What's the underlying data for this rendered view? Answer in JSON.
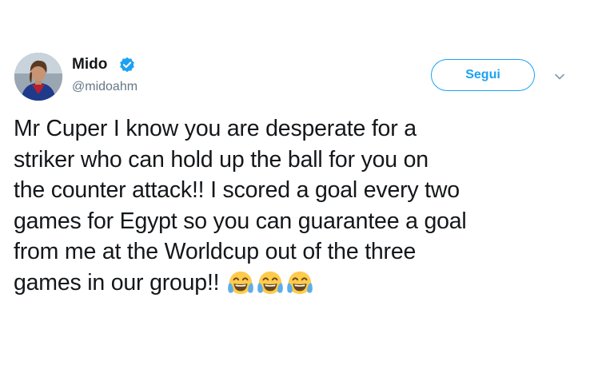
{
  "user": {
    "display_name": "Mido",
    "handle": "@midoahm",
    "verified": true
  },
  "follow_button": {
    "label": "Segui"
  },
  "tweet": {
    "lines": [
      "Mr Cuper I know you are desperate for a",
      "striker who can hold up the ball for you on",
      "the counter attack!! I scored a goal every two",
      "games for Egypt so you can guarantee a goal",
      "from me at the Worldcup out of the three",
      "games in our group!!"
    ],
    "emojis": [
      "face-with-tears-of-joy-icon",
      "face-with-tears-of-joy-icon",
      "face-with-tears-of-joy-icon"
    ]
  },
  "colors": {
    "accent": "#1da1f2",
    "text": "#14171a",
    "secondary_text": "#657786"
  }
}
